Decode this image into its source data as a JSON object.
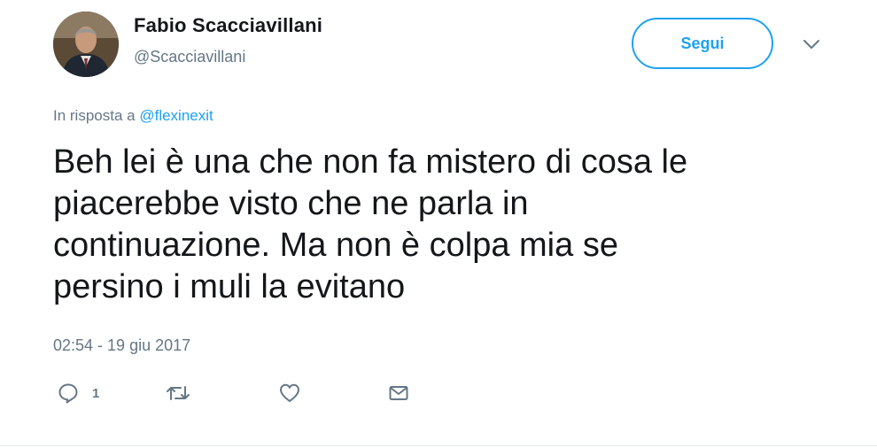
{
  "author": {
    "display_name": "Fabio Scacciavillani",
    "handle": "@Scacciavillani"
  },
  "follow_button": {
    "label": "Segui"
  },
  "reply_context": {
    "prefix": "In risposta a",
    "mention": "@flexinexit"
  },
  "tweet": {
    "text_lines": [
      "Beh lei è una che non fa mistero di cosa le",
      "piacerebbe visto che ne parla in",
      "continuazione. Ma non è colpa mia se",
      "persino i muli la evitano"
    ],
    "timestamp": "02:54 - 19 giu 2017"
  },
  "actions": {
    "reply": {
      "icon": "reply-icon",
      "count": "1"
    },
    "retweet": {
      "icon": "retweet-icon"
    },
    "like": {
      "icon": "heart-icon"
    },
    "dm": {
      "icon": "envelope-icon"
    }
  },
  "colors": {
    "accent": "#1da1f2",
    "text": "#14171a",
    "secondary": "#657786"
  }
}
